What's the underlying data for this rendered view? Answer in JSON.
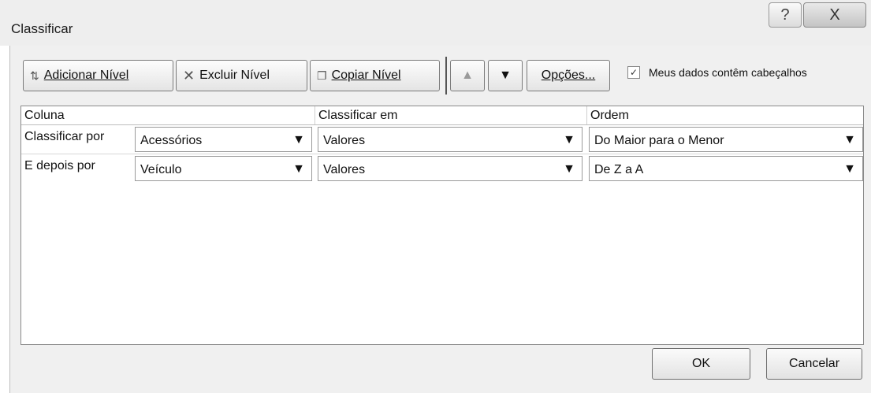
{
  "window": {
    "title": "Classificar",
    "help_glyph": "?",
    "close_glyph": "X"
  },
  "toolbar": {
    "add_level": "Adicionar Nível",
    "delete_level": "Excluir Nível",
    "copy_level": "Copiar Nível",
    "move_up_glyph": "▲",
    "move_down_glyph": "▼",
    "options": "Opções...",
    "has_headers_checked": true,
    "has_headers_label": "Meus dados contêm cabeçalhos"
  },
  "grid": {
    "headers": [
      "Coluna",
      "Classificar em",
      "Ordem"
    ],
    "rows": [
      {
        "label": "Classificar por",
        "column": "Acessórios",
        "sort_on": "Valores",
        "order": "Do Maior para o Menor"
      },
      {
        "label": "E depois por",
        "column": "Veículo",
        "sort_on": "Valores",
        "order": "De Z a A"
      }
    ]
  },
  "footer": {
    "ok": "OK",
    "cancel": "Cancelar"
  }
}
